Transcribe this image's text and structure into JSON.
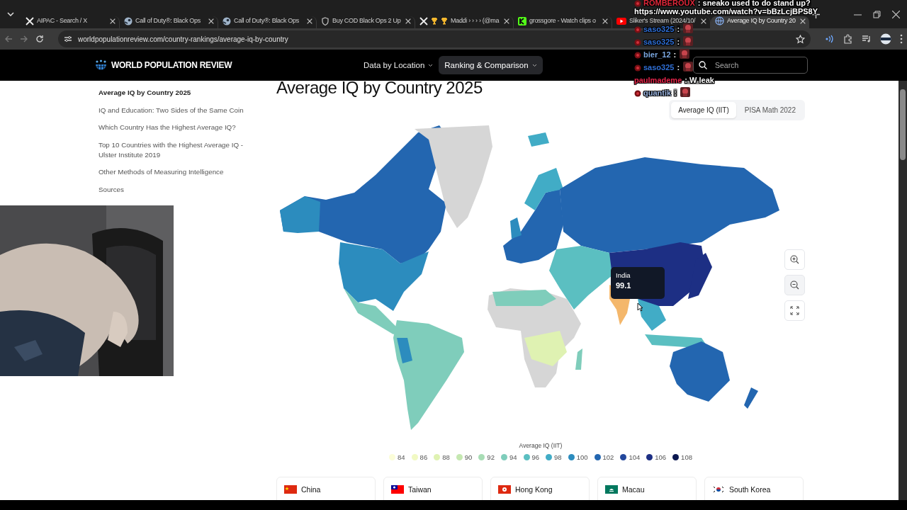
{
  "browser": {
    "tabs": [
      {
        "title": "AIPAC - Search / X",
        "kind": "x",
        "selected": false
      },
      {
        "title": "Call of Duty®: Black Ops",
        "kind": "steam",
        "selected": false
      },
      {
        "title": "Call of Duty®: Black Ops",
        "kind": "steam",
        "selected": false
      },
      {
        "title": "Buy COD Black Ops 2 Up",
        "kind": "shield",
        "selected": false
      },
      {
        "title": "Maddi › › › › (@ma",
        "kind": "x_trophies",
        "selected": false
      },
      {
        "title": "grossgore - Watch clips o",
        "kind": "kick",
        "selected": false
      },
      {
        "title": "Sliker's Stream (2024/10/",
        "kind": "youtube",
        "selected": false
      },
      {
        "title": "Average IQ by Country 20",
        "kind": "globe",
        "selected": true
      }
    ],
    "url": "worldpopulationreview.com/country-rankings/average-iq-by-country"
  },
  "chat_overlay": {
    "messages": [
      {
        "user": "ROMBEROUX",
        "text": ": sneako used to do stand up?",
        "link": "https://www.youtube.com/watch?v=bBzLcjBPS8Y",
        "color": "#e0283a",
        "badge": true,
        "emote": false
      },
      {
        "user": "saso325",
        "text": ":",
        "color": "#2f6fd6",
        "badge": true,
        "emote": true
      },
      {
        "user": "saso325",
        "text": ":",
        "color": "#2f6fd6",
        "badge": true,
        "emote": true
      },
      {
        "user": "bier_12",
        "text": ":",
        "color": "#7aa7e0",
        "badge": true,
        "emote": true
      },
      {
        "user": "saso325",
        "text": ":",
        "color": "#2f6fd6",
        "badge": true,
        "emote": true
      },
      {
        "user": "paulmademe",
        "text": ": W leak",
        "color": "#e8244a",
        "badge": false,
        "emote": false
      },
      {
        "user": "quantik",
        "text": ":",
        "color": "#9bb4e0",
        "badge": true,
        "emote": true
      }
    ]
  },
  "site": {
    "logo": "WORLD POPULATION REVIEW",
    "nav": [
      {
        "label": "Data by Location",
        "selected": false
      },
      {
        "label": "Ranking & Comparison",
        "selected": true
      }
    ],
    "search": {
      "placeholder": "Search"
    }
  },
  "sidebar": {
    "items": [
      {
        "label": "Average IQ by Country 2025",
        "selected": true
      },
      {
        "label": "IQ and Education: Two Sides of the Same Coin",
        "selected": false
      },
      {
        "label": "Which Country Has the Highest Average IQ?",
        "selected": false
      },
      {
        "label": "Top 10 Countries with the Highest Average IQ - Ulster Institute 2019",
        "selected": false
      },
      {
        "label": "Other Methods of Measuring Intelligence",
        "selected": false
      },
      {
        "label": "Sources",
        "selected": false
      }
    ]
  },
  "main": {
    "title": "Average IQ by Country 2025",
    "toggle": [
      {
        "label": "Average IQ (IIT)",
        "selected": true
      },
      {
        "label": "PISA Math 2022",
        "selected": false
      }
    ],
    "map": {
      "tooltip": {
        "country": "India",
        "value": "99.1"
      }
    },
    "legend": {
      "title": "Average IQ (IIT)",
      "items": [
        {
          "label": "84",
          "color": "#fbfdd8"
        },
        {
          "label": "86",
          "color": "#f1f9c3"
        },
        {
          "label": "88",
          "color": "#dff2b2"
        },
        {
          "label": "90",
          "color": "#c5e8b1"
        },
        {
          "label": "92",
          "color": "#a8ddb5"
        },
        {
          "label": "94",
          "color": "#7fcdbb"
        },
        {
          "label": "96",
          "color": "#5bbfc1"
        },
        {
          "label": "98",
          "color": "#41acc6"
        },
        {
          "label": "100",
          "color": "#2c8cbe"
        },
        {
          "label": "102",
          "color": "#2366b0"
        },
        {
          "label": "104",
          "color": "#23479c"
        },
        {
          "label": "106",
          "color": "#1d2f84"
        },
        {
          "label": "108",
          "color": "#0c1850"
        }
      ]
    },
    "cards": [
      {
        "country": "China",
        "kind": "cn"
      },
      {
        "country": "Taiwan",
        "kind": "tw"
      },
      {
        "country": "Hong Kong",
        "kind": "hk"
      },
      {
        "country": "Macau",
        "kind": "mo"
      },
      {
        "country": "South Korea",
        "kind": "kr"
      }
    ]
  }
}
